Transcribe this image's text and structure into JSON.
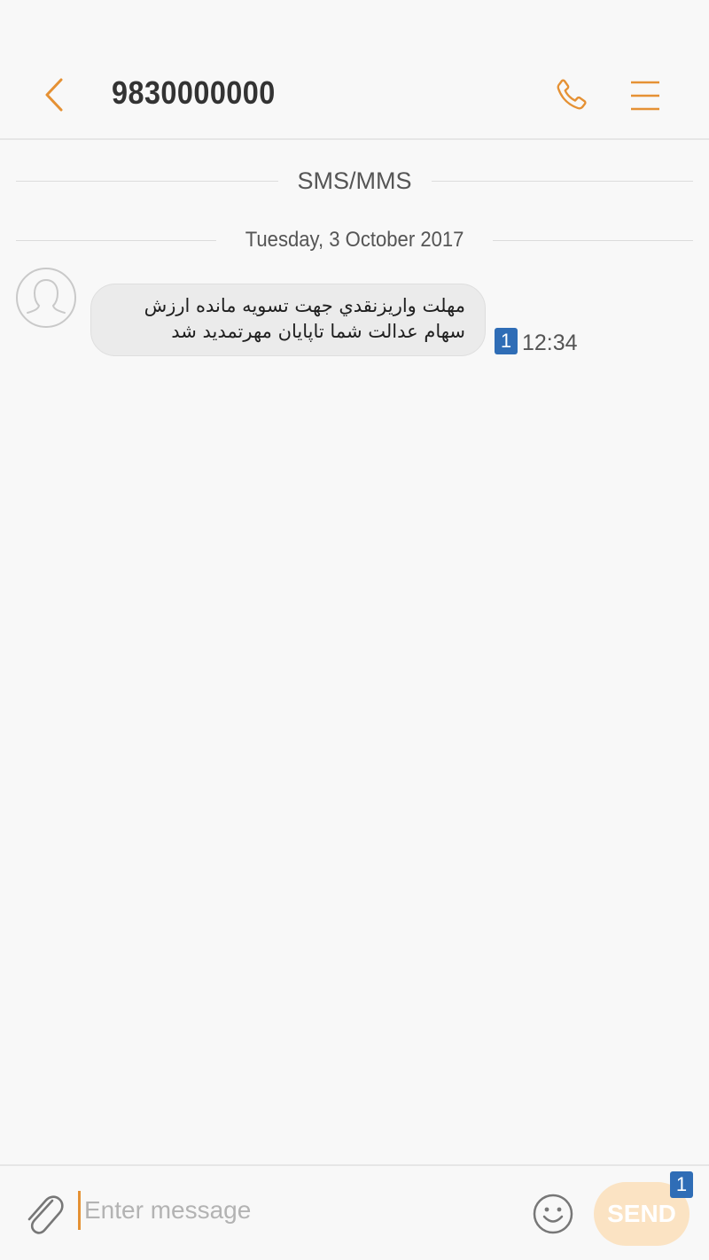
{
  "header": {
    "title": "9830000000"
  },
  "conversation": {
    "channel_label": "SMS/MMS",
    "date_label": "Tuesday, 3 October 2017",
    "messages": [
      {
        "line1": "مهلت واريزنقدي جهت تسويه مانده ارزش",
        "line2": "سهام عدالت شما تاپايان مهرتمديد شد",
        "sim": "1",
        "time": "12:34"
      }
    ]
  },
  "composer": {
    "placeholder": "Enter message",
    "send_label": "SEND",
    "sim": "1"
  },
  "colors": {
    "accent": "#e59134",
    "sim_badge": "#2f6db6",
    "send_disabled": "#fbe3c3"
  }
}
